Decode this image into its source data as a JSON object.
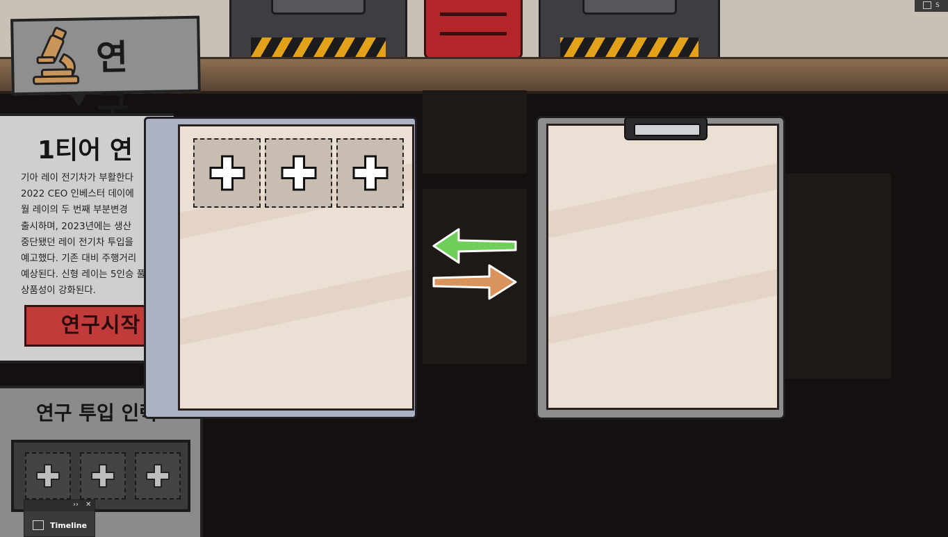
{
  "header": {
    "title": "연 구",
    "icon": "microscope-icon"
  },
  "research": {
    "tier_title": "1티어 연",
    "description_lines": [
      "기아 레이 전기차가 부활한다",
      "2022 CEO 인베스터 데이에",
      "월 레이의 두 번째 부분변경",
      "출시하며, 2023년에는 생산",
      "중단됐던 레이 전기차 투입을",
      "예고했다. 기존 대비 주행거리",
      "예상된다. 신형 레이는 5인승 풀",
      "상품성이 강화된다."
    ],
    "start_button": "연구시작"
  },
  "manpower": {
    "title": "연구 투입 인력",
    "slot_count": 3,
    "slot_icon": "plus-icon"
  },
  "left_board": {
    "slot_count": 3,
    "slot_icon": "plus-icon"
  },
  "arrows": {
    "left_color": "#6fcf5a",
    "right_color": "#d9935c"
  },
  "colors": {
    "start_button": "#c23b3b",
    "paper": "#ecdfd4",
    "board": "#aab2c4"
  },
  "editor": {
    "timeline_label": "Timeline",
    "corner_label": "S"
  }
}
